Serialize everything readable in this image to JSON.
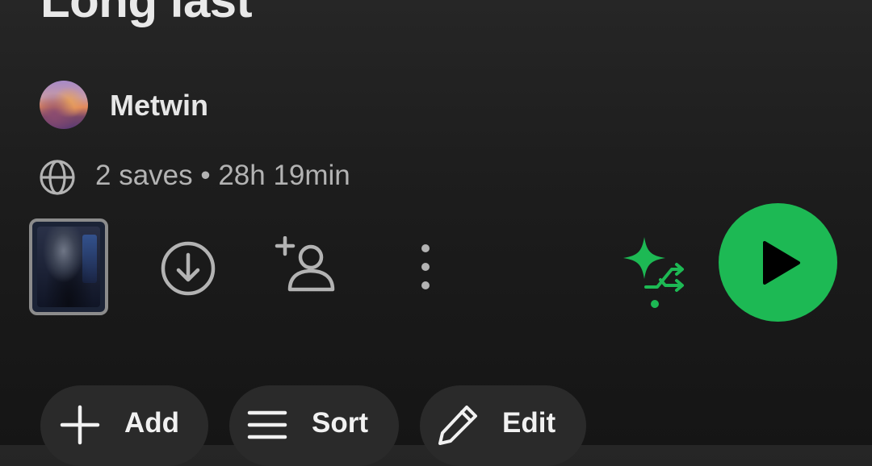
{
  "playlist": {
    "title": "Long last",
    "owner": {
      "name": "Metwin",
      "avatar_icon": "user-avatar"
    },
    "meta": {
      "visibility_icon": "globe-icon",
      "text": "2 saves • 28h 19min"
    }
  },
  "actions": {
    "cover_thumb_icon": "playlist-cover-thumbnail",
    "download_icon": "download-circle-icon",
    "add_collaborator_icon": "add-user-icon",
    "more_icon": "more-vertical-icon",
    "smart_shuffle_icon": "smart-shuffle-icon",
    "play_icon": "play-icon"
  },
  "chips": [
    {
      "label": "Add",
      "icon": "plus-icon"
    },
    {
      "label": "Sort",
      "icon": "sort-lines-icon"
    },
    {
      "label": "Edit",
      "icon": "pencil-icon"
    }
  ],
  "colors": {
    "accent_green": "#1db954",
    "background": "#1c1c1c",
    "chip_background": "#2a2a2a",
    "secondary_text": "#b3b3b3"
  }
}
